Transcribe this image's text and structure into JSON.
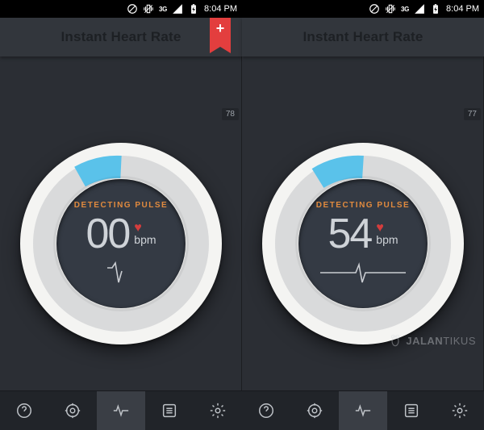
{
  "statusbar": {
    "network": "3G",
    "clock": "8:04 PM"
  },
  "left": {
    "title": "Instant Heart Rate",
    "ribbon": "+",
    "badge": "78",
    "status": "DETECTING PULSE",
    "bpm": "00",
    "unit": "bpm"
  },
  "right": {
    "title": "Instant Heart Rate",
    "badge": "77",
    "status": "DETECTING PULSE",
    "bpm": "54",
    "unit": "bpm"
  },
  "watermark": {
    "brand": "JALAN",
    "brand2": "TIKUS"
  },
  "colors": {
    "accent": "#e08a3e",
    "heart": "#d43d3d",
    "arc": "#5ac2ea"
  }
}
